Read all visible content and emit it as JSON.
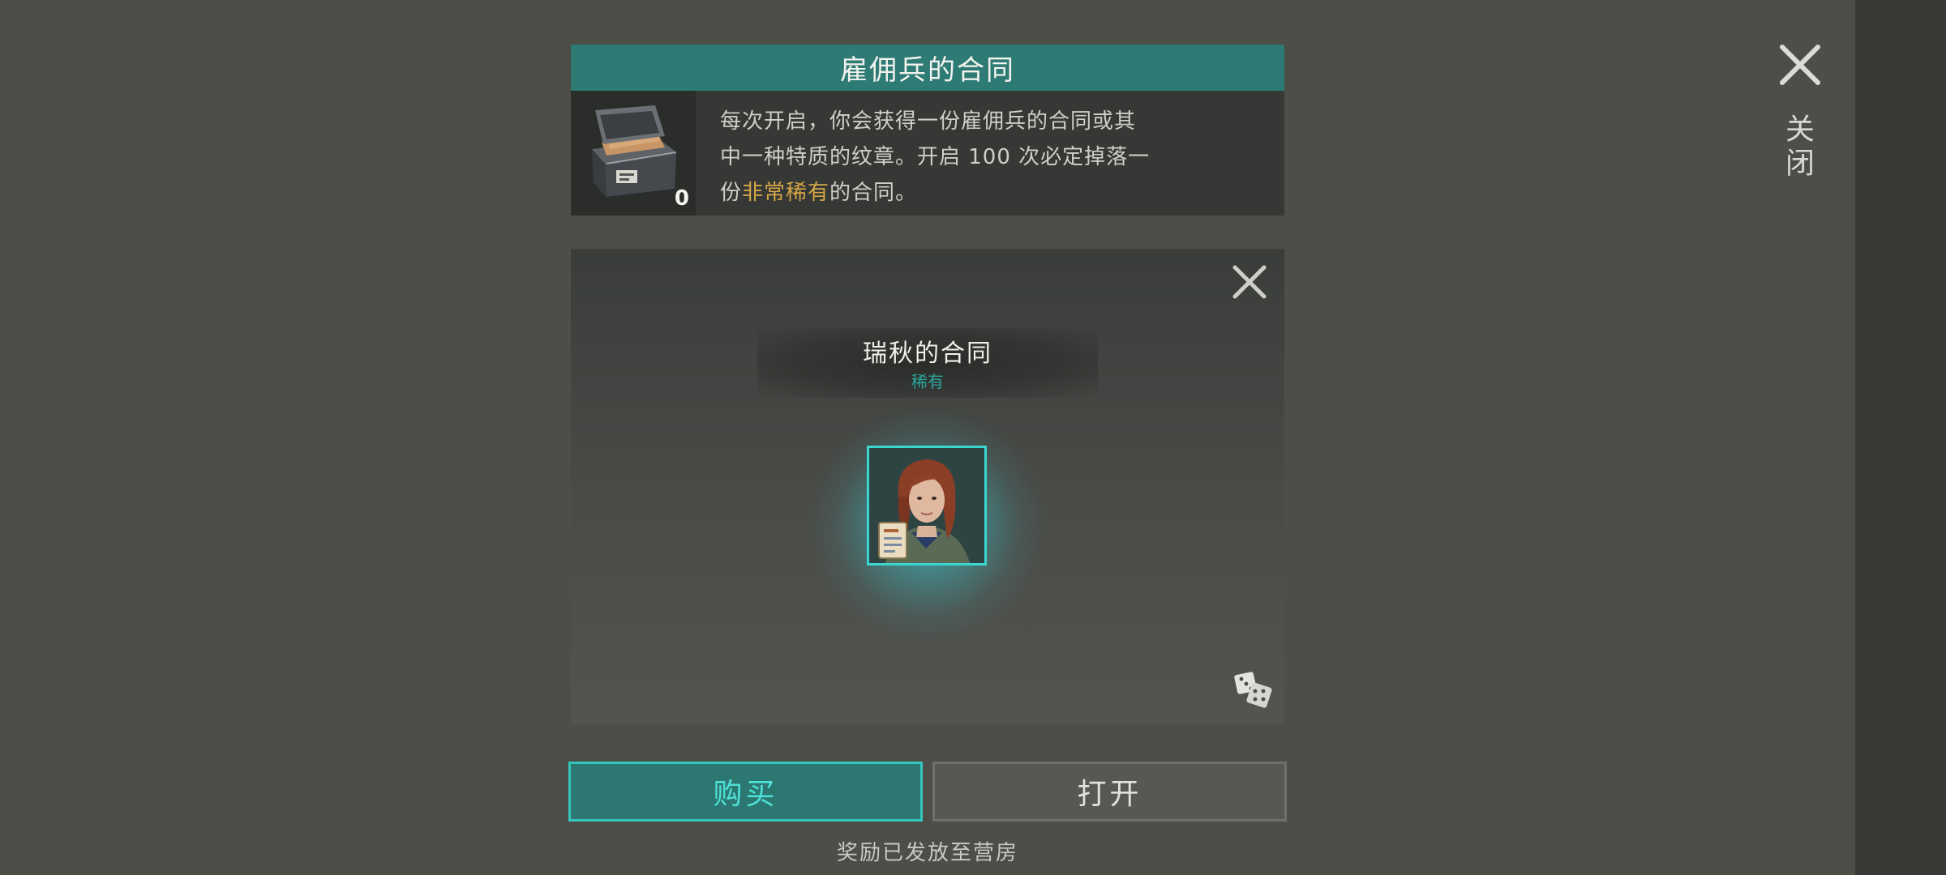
{
  "sidebar": {
    "close_label": "关闭"
  },
  "header": {
    "title": "雇佣兵的合同"
  },
  "chest": {
    "count": "0"
  },
  "description": {
    "line1": "每次开启，你会获得一份雇佣兵的合同或其",
    "line2": "中一种特质的纹章。开启 100 次必定掉落一",
    "line3_prefix": "份",
    "line3_highlight": "非常稀有",
    "line3_suffix": "的合同。"
  },
  "reward": {
    "name": "瑞秋的合同",
    "rarity": "稀有"
  },
  "buttons": {
    "buy": "购买",
    "open": "打开"
  },
  "footer": {
    "note": "奖励已发放至营房"
  },
  "colors": {
    "accent": "#2e7a74",
    "highlight": "#d6a646",
    "rarity": "#2aa69c",
    "buy_text": "#4fe0d6"
  }
}
